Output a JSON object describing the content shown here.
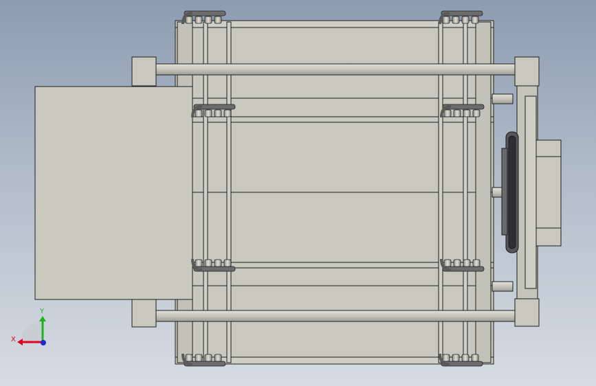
{
  "viewport": {
    "background_top": "#8d9cb1",
    "background_bottom": "#d6dce3"
  },
  "model": {
    "part_fill": "#c8c8bf",
    "part_fill_dark": "#b9b9b0",
    "edge_color": "#1e1e1e",
    "shade_color": "#5a5a5a",
    "roller_count_per_cluster": 2
  },
  "triad": {
    "x_label": "X",
    "y_label": "Y",
    "x_color": "#e1001e",
    "y_color": "#1eb41e",
    "z_color": "#1e2ad2",
    "origin_icon": "axis-origin-dot"
  }
}
